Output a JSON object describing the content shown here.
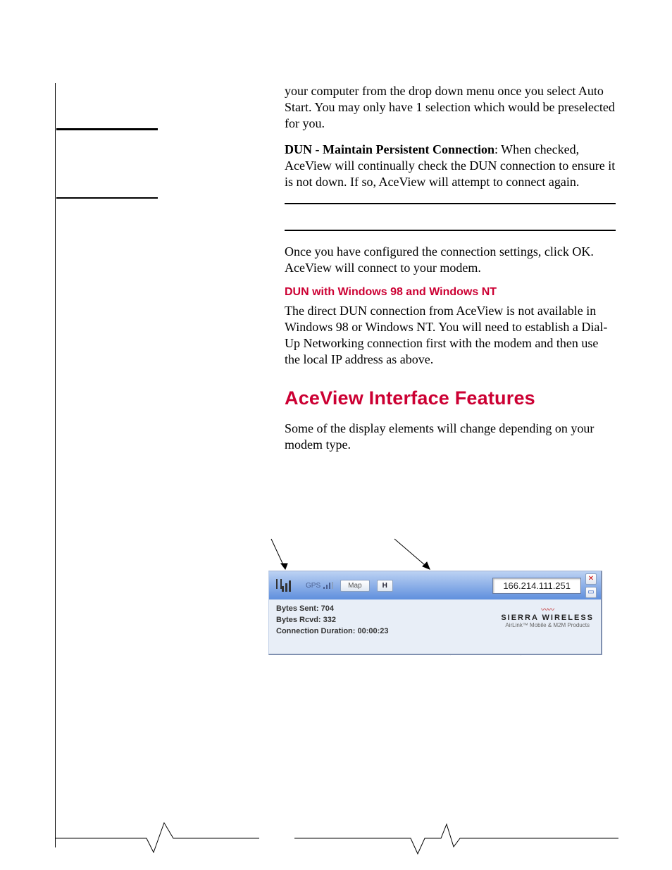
{
  "paragraphs": {
    "intro": "your computer from the drop down menu once you select Auto Start. You may only have 1 selection which would be preselected for you.",
    "dun_label": "DUN - Maintain Persistent Connection",
    "dun_text": ": When checked, AceView will continually check the DUN connection to ensure it is not down. If so, AceView will attempt to connect again.",
    "after_rule": "Once you have configured the connection settings, click OK. AceView will connect to your modem.",
    "sub_heading": "DUN with Windows 98 and Windows NT",
    "dun98_text": "The direct DUN connection from AceView is not available in Windows 98 or Windows NT.  You will need to establish a Dial-Up Networking connection first with the modem and then use the local IP address as above.",
    "main_heading": "AceView Interface Features",
    "feat_text": "Some of the display elements will change depending on your modem type."
  },
  "figure": {
    "gps_label": "GPS",
    "map_button": "Map",
    "h_button": "H",
    "ip_address": "166.214.111.251",
    "close_glyph": "✕",
    "min_glyph": "▭",
    "bytes_sent_label": "Bytes Sent:",
    "bytes_sent_value": "704",
    "bytes_rcvd_label": "Bytes Rcvd:",
    "bytes_rcvd_value": "332",
    "conn_dur_label": "Connection Duration:",
    "conn_dur_value": "00:00:23",
    "brand_name": "SIERRA WIRELESS",
    "brand_sub": "AirLink™ Mobile & M2M Products"
  }
}
